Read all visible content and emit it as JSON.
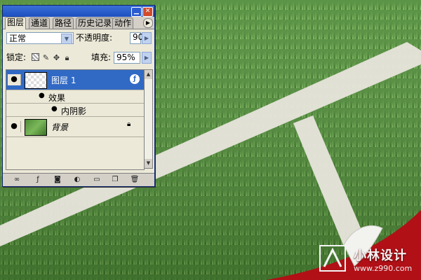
{
  "window": {
    "min_glyph": "▁",
    "close_glyph": "✕"
  },
  "tabs": [
    {
      "label": "图层",
      "active": true
    },
    {
      "label": "通道",
      "active": false
    },
    {
      "label": "路径",
      "active": false
    },
    {
      "label": "历史记录",
      "active": false
    },
    {
      "label": "动作",
      "active": false
    }
  ],
  "blend": {
    "mode": "正常",
    "opacity_label": "不透明度:",
    "opacity_value": "90%"
  },
  "lock": {
    "label": "锁定:",
    "icons": [
      "lock-transparent-icon",
      "brush-icon",
      "move-icon",
      "lock-icon"
    ]
  },
  "fill": {
    "label": "填充:",
    "value": "95%"
  },
  "layers": [
    {
      "name": "图层 1",
      "selected": true,
      "visible": true
    },
    {
      "name": "效果",
      "type": "effects-group"
    },
    {
      "name": "内阴影",
      "type": "effect"
    },
    {
      "name": "背景",
      "selected": false,
      "visible": true,
      "locked": true
    }
  ],
  "footer_icons": [
    "link-icon",
    "add-style-icon",
    "add-mask-icon",
    "adjustment-icon",
    "new-group-icon",
    "new-layer-icon",
    "trash-icon"
  ],
  "watermark": {
    "title": "小林设计",
    "url": "www.z990.com"
  },
  "colors": {
    "grass": "#4d8a35",
    "selection": "#316ac5",
    "red_curl": "#b01016",
    "stripe": "#e8e5dc"
  }
}
